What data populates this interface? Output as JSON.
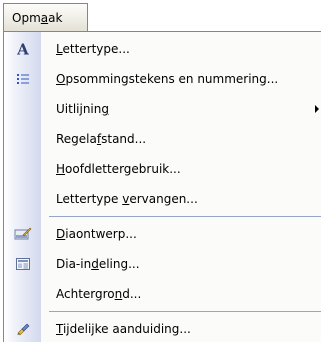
{
  "menu": {
    "title": {
      "pre": "Opm",
      "key": "a",
      "post": "ak"
    },
    "items": [
      {
        "pre": "",
        "key": "L",
        "post": "ettertype...",
        "icon": "font-letter-a-icon",
        "submenu": false
      },
      {
        "pre": "",
        "key": "O",
        "post": "psommingstekens en nummering...",
        "icon": "bullet-list-icon",
        "submenu": false
      },
      {
        "pre": "Uitlijnin",
        "key": "g",
        "post": "",
        "icon": "",
        "submenu": true
      },
      {
        "pre": "Regela",
        "key": "f",
        "post": "stand...",
        "icon": "",
        "submenu": false
      },
      {
        "pre": "",
        "key": "H",
        "post": "oofdlettergebruik...",
        "icon": "",
        "submenu": false
      },
      {
        "pre": "Lettertype ",
        "key": "v",
        "post": "ervangen...",
        "icon": "",
        "submenu": false
      },
      {
        "pre": "",
        "key": "D",
        "post": "iaontwerp...",
        "icon": "slide-design-icon",
        "submenu": false
      },
      {
        "pre": "Dia-in",
        "key": "d",
        "post": "eling...",
        "icon": "slide-layout-icon",
        "submenu": false
      },
      {
        "pre": "Achtergro",
        "key": "n",
        "post": "d...",
        "icon": "",
        "submenu": false
      },
      {
        "pre": "",
        "key": "T",
        "post": "ijdelijke aanduiding...",
        "icon": "placeholder-brush-icon",
        "submenu": false
      }
    ]
  },
  "colors": {
    "menu_background": "#fbfbfa",
    "icon_strip_end": "#d3d9ee",
    "separator": "#97a6c8",
    "border": "#8a867a"
  }
}
